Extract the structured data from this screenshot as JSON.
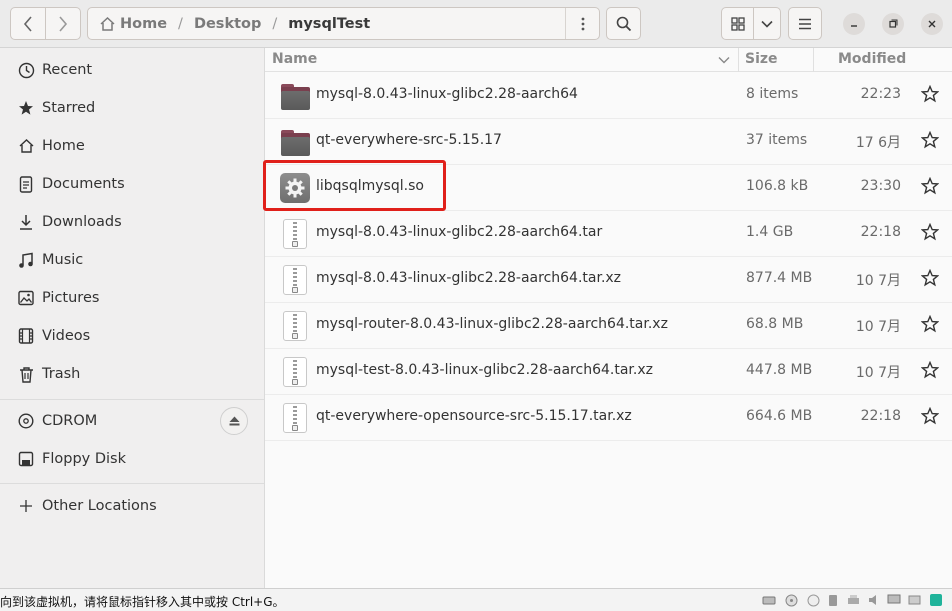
{
  "header": {
    "breadcrumbs": [
      "Home",
      "Desktop",
      "mysqlTest"
    ],
    "icons": {
      "back": "chevron-left-icon",
      "forward": "chevron-right-icon",
      "home": "home-icon",
      "path_menu": "vertical-dots-icon",
      "search": "search-icon",
      "view": "grid-view-icon",
      "view_dropdown": "chevron-down-icon",
      "menu": "hamburger-icon",
      "minimize": "minimize-icon",
      "maximize": "maximize-icon",
      "close": "close-icon"
    }
  },
  "sidebar": {
    "items": [
      {
        "label": "Recent",
        "icon": "clock-icon"
      },
      {
        "label": "Starred",
        "icon": "star-icon"
      },
      {
        "label": "Home",
        "icon": "home-icon"
      },
      {
        "label": "Documents",
        "icon": "document-icon"
      },
      {
        "label": "Downloads",
        "icon": "download-icon"
      },
      {
        "label": "Music",
        "icon": "music-icon"
      },
      {
        "label": "Pictures",
        "icon": "picture-icon"
      },
      {
        "label": "Videos",
        "icon": "video-icon"
      },
      {
        "label": "Trash",
        "icon": "trash-icon"
      }
    ],
    "devices": [
      {
        "label": "CDROM",
        "icon": "disc-icon",
        "eject": "eject-icon"
      },
      {
        "label": "Floppy Disk",
        "icon": "floppy-icon"
      }
    ],
    "other": {
      "label": "Other Locations",
      "icon": "plus-icon"
    }
  },
  "columns": {
    "name": "Name",
    "size": "Size",
    "modified": "Modified",
    "sort_icon": "chevron-down-icon"
  },
  "files": [
    {
      "name": "mysql-8.0.43-linux-glibc2.28-aarch64",
      "size": "8 items",
      "modified": "22:23",
      "type": "folder",
      "starred": false
    },
    {
      "name": "qt-everywhere-src-5.15.17",
      "size": "37 items",
      "modified": "17 6月",
      "type": "folder",
      "starred": false
    },
    {
      "name": "libqsqlmysql.so",
      "size": "106.8 kB",
      "modified": "23:30",
      "type": "library",
      "starred": false,
      "highlighted": true
    },
    {
      "name": "mysql-8.0.43-linux-glibc2.28-aarch64.tar",
      "size": "1.4 GB",
      "modified": "22:18",
      "type": "archive",
      "starred": false
    },
    {
      "name": "mysql-8.0.43-linux-glibc2.28-aarch64.tar.xz",
      "size": "877.4 MB",
      "modified": "10 7月",
      "type": "archive",
      "starred": false
    },
    {
      "name": "mysql-router-8.0.43-linux-glibc2.28-aarch64.tar.xz",
      "size": "68.8 MB",
      "modified": "10 7月",
      "type": "archive",
      "starred": false
    },
    {
      "name": "mysql-test-8.0.43-linux-glibc2.28-aarch64.tar.xz",
      "size": "447.8 MB",
      "modified": "10 7月",
      "type": "archive",
      "starred": false
    },
    {
      "name": "qt-everywhere-opensource-src-5.15.17.tar.xz",
      "size": "664.6 MB",
      "modified": "22:18",
      "type": "archive",
      "starred": false
    }
  ],
  "statusbar": {
    "message": "向到该虚拟机，请将鼠标指针移入其中或按 Ctrl+G。"
  },
  "colors": {
    "highlight_border": "#e0201a",
    "folder_tab": "#7a3f4e",
    "folder_body": "#5a5a5a"
  }
}
